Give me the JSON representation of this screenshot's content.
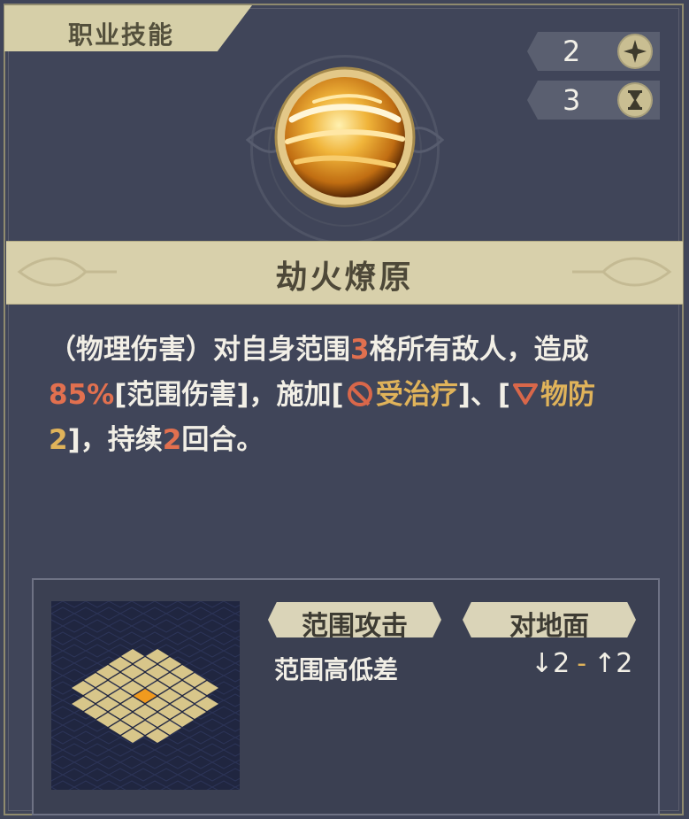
{
  "tab": {
    "label": "职业技能"
  },
  "stats": {
    "cost": {
      "value": "2",
      "icon": "sparkle-icon"
    },
    "cooldown": {
      "value": "3",
      "icon": "hourglass-icon"
    }
  },
  "skill": {
    "icon": "fire-vortex-orb-icon",
    "name": "劫火燎原",
    "desc": {
      "p1": "（物理伤害）对自身范围",
      "n1": "3",
      "p2": "格所有敌人，造成",
      "pct": "85%",
      "p3": "[范围伤害]，施加[",
      "debuff1": "受治疗",
      "p4": "]、[",
      "debuff2": "物防2",
      "p5": "]，持续",
      "n2": "2",
      "p6": "回合。"
    }
  },
  "attack_info": {
    "tag1": "范围攻击",
    "tag2": "对地面",
    "range_label": "范围高低差",
    "down_arrow": "↓",
    "down_val": "2",
    "dash": "-",
    "up_arrow": "↑",
    "up_val": "2"
  },
  "colors": {
    "accent_red": "#e2704f",
    "accent_gold": "#e0b35a",
    "tile": "#d8c68a",
    "center_tile": "#f09a1e"
  }
}
